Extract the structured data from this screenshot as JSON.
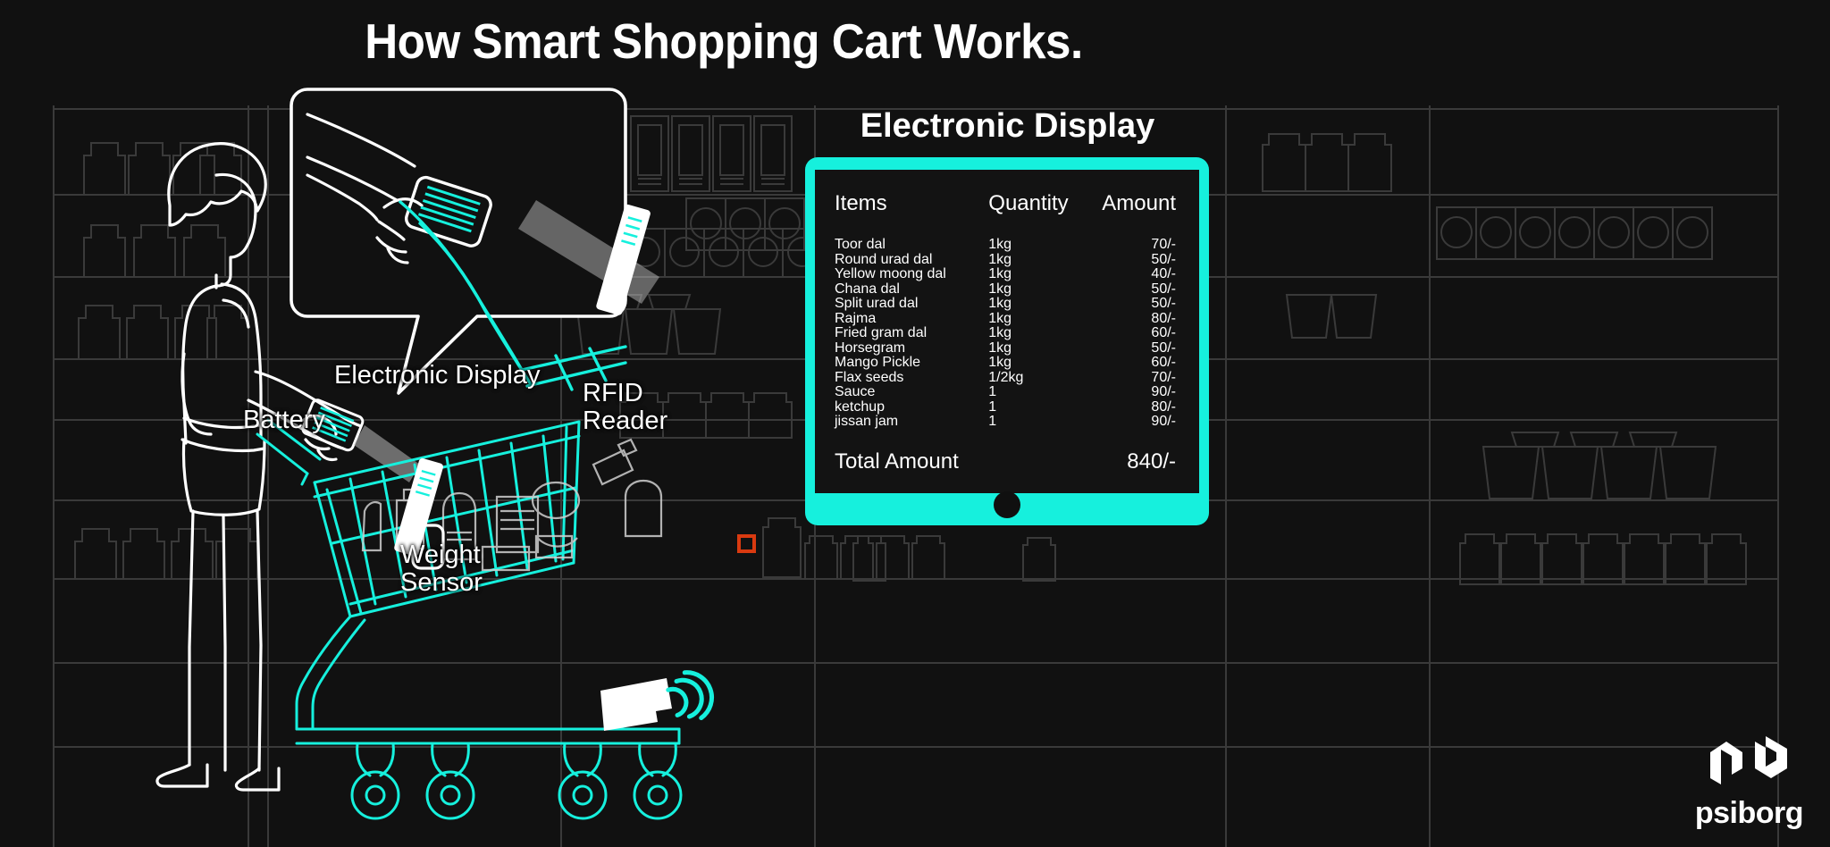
{
  "page": {
    "title": "How Smart Shopping Cart Works.",
    "background_color": "#111111",
    "accent_color": "#16f0dd",
    "line_color": "#ffffff",
    "shelf_color": "#3a3a3a",
    "marker_color": "#d93a10"
  },
  "illustration": {
    "labels": {
      "electronic_display": "Electronic Display",
      "battery": "Battery",
      "rfid_reader": "RFID\nReader",
      "weight_sensor": "Weight\nSensor"
    },
    "icons": {
      "wireless_signal": "wireless-signal-icon",
      "rfid_marker": "rfid-marker-icon"
    },
    "callout": {
      "name": "magnified-scan-callout",
      "description": "hand scanning a product past the barcode scanner on the cart"
    }
  },
  "display": {
    "heading": "Electronic Display",
    "columns": [
      "Items",
      "Quantity",
      "Amount"
    ],
    "rows": [
      {
        "item": "Toor dal",
        "quantity": "1kg",
        "amount": "70/-"
      },
      {
        "item": "Round urad dal",
        "quantity": "1kg",
        "amount": "50/-"
      },
      {
        "item": "Yellow moong dal",
        "quantity": "1kg",
        "amount": "40/-"
      },
      {
        "item": "Chana dal",
        "quantity": "1kg",
        "amount": "50/-"
      },
      {
        "item": "Split urad dal",
        "quantity": "1kg",
        "amount": "50/-"
      },
      {
        "item": "Rajma",
        "quantity": "1kg",
        "amount": "80/-"
      },
      {
        "item": "Fried gram dal",
        "quantity": "1kg",
        "amount": "60/-"
      },
      {
        "item": "Horsegram",
        "quantity": "1kg",
        "amount": "50/-"
      },
      {
        "item": "Mango Pickle",
        "quantity": "1kg",
        "amount": "60/-"
      },
      {
        "item": "Flax seeds",
        "quantity": "1/2kg",
        "amount": "70/-"
      },
      {
        "item": "Sauce",
        "quantity": "1",
        "amount": "90/-"
      },
      {
        "item": "ketchup",
        "quantity": "1",
        "amount": "80/-"
      },
      {
        "item": "jissan jam",
        "quantity": "1",
        "amount": "90/-"
      }
    ],
    "total_label": "Total Amount",
    "total_amount": "840/-"
  },
  "logo": {
    "wordmark": "psiborg",
    "monogram": "pb-monogram-icon"
  }
}
